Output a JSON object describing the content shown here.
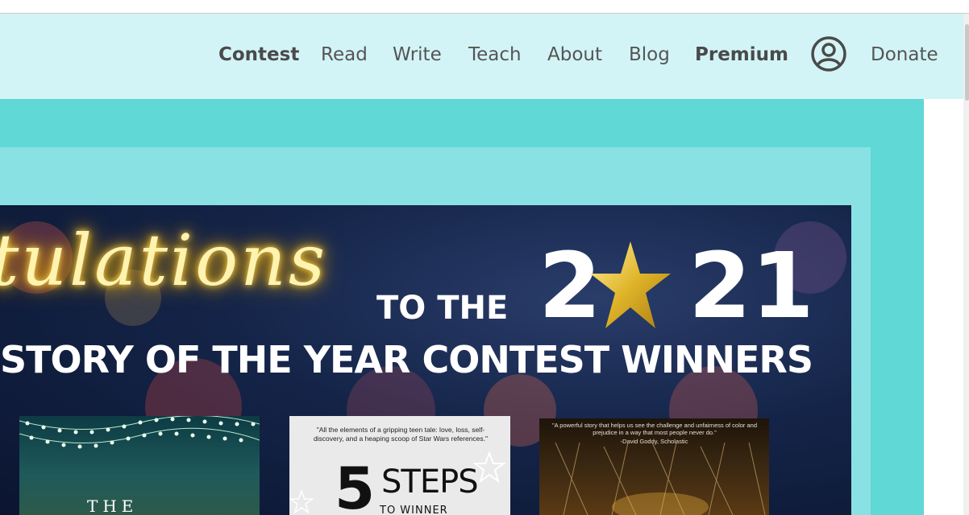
{
  "nav": {
    "contest": "Contest",
    "read": "Read",
    "write": "Write",
    "teach": "Teach",
    "about": "About",
    "blog": "Blog",
    "premium": "Premium",
    "account_icon": "user-circle-icon",
    "donate": "Donate"
  },
  "banner": {
    "script_text": "tulations",
    "to_the": "TO THE",
    "year_start": "2",
    "year_end": "21",
    "subtitle": "STORY OF THE YEAR CONTEST WINNERS"
  },
  "books": {
    "book1_title": "THE",
    "book2_quote": "\"All the elements of a gripping teen tale: love, loss, self-discovery, and a heaping scoop of Star Wars references.\"",
    "book2_number": "5",
    "book2_title": "STEPS",
    "book2_subtitle": "TO WINNER",
    "book3_quote": "\"A powerful story that helps us see the challenge and unfairness of color and prejudice in a way that most people never do.\"",
    "book3_attribution": "-David Goddy, Scholastic"
  },
  "colors": {
    "nav_bg": "#d3f4f6",
    "nav_text": "#555555",
    "hero_outer": "#5fd8d6",
    "hero_inner": "#8ae1e3",
    "banner_bg": "#142448",
    "glow_gold": "#f5b400"
  }
}
